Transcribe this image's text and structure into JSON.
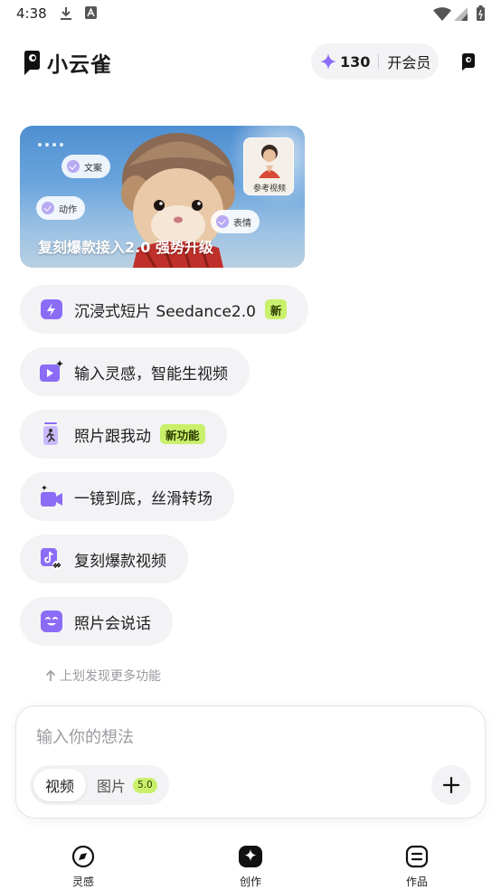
{
  "status_bar": {
    "time": "4:38"
  },
  "header": {
    "app_name": "小云雀",
    "credits": "130",
    "member_label": "开会员"
  },
  "banner": {
    "caption": "复刻爆款接入2.0 强势升级",
    "ref_label": "参考视频",
    "tags": [
      "文案",
      "动作",
      "表情"
    ]
  },
  "features": [
    {
      "label": "沉浸式短片 Seedance2.0",
      "badge": "新",
      "icon": "lightning-icon"
    },
    {
      "label": "输入灵感，智能生视频",
      "badge": "",
      "icon": "video-sparkle-icon"
    },
    {
      "label": "照片跟我动",
      "badge": "新功能",
      "icon": "photo-motion-icon"
    },
    {
      "label": "一镜到底，丝滑转场",
      "badge": "",
      "icon": "camera-sparkle-icon"
    },
    {
      "label": "复刻爆款视频",
      "badge": "",
      "icon": "tiktok-link-icon"
    },
    {
      "label": "照片会说话",
      "badge": "",
      "icon": "smile-face-icon"
    }
  ],
  "hint": "上划发现更多功能",
  "composer": {
    "placeholder": "输入你的想法",
    "mode_video": "视频",
    "mode_image": "图片",
    "image_version": "5.0"
  },
  "nav": {
    "items": [
      {
        "label": "灵感",
        "icon": "compass-icon"
      },
      {
        "label": "创作",
        "icon": "create-sparkle-icon"
      },
      {
        "label": "作品",
        "icon": "works-icon"
      }
    ]
  },
  "colors": {
    "accent_purple": "#8b6cf6",
    "badge_green": "#c9f06b",
    "pill_bg": "#f3f3f5"
  }
}
